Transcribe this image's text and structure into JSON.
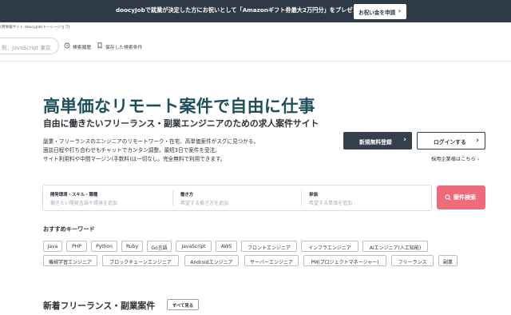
{
  "banner": {
    "text": "doocyJobで就業が決定した方にお祝いとして「Amazonギフト券最大2万円分」をプレゼント🎉",
    "button_label": "お祝い金を申請"
  },
  "header": {
    "tagline": "(用情報サイト doocyJob(ドーシージョブ)",
    "search_placeholder": "例：JavaScript 東京",
    "history_label": "検索履歴",
    "saved_label": "保存した検索条件"
  },
  "hero": {
    "title": "高単価なリモート案件で自由に仕事",
    "subtitle": "自由に働きたいフリーランス・副業エンジニアのための求人案件サイト",
    "description": [
      "副業・フリーランスのエンジニアのリモートワーク・在宅、高単価案件がスグに見つかる。",
      "面談日程や打ち合わせもチャットでカンタン調整。最短3日で案件を受注。",
      "サイト利用料や中間マージン(手数料)は一切なし。完全無料で利用できます。"
    ],
    "register_label": "新規無料登録",
    "login_label": "ログインする",
    "employer_link": "採用企業様はこちら"
  },
  "search": {
    "fields": [
      {
        "label": "開発環境・スキル・職種",
        "placeholder": "働きたい開発言語や環境を追加"
      },
      {
        "label": "働き方",
        "placeholder": "希望する働き方を追加"
      },
      {
        "label": "単価",
        "placeholder": "希望する単価を追加"
      }
    ],
    "button_label": "案件検索"
  },
  "keywords": {
    "heading": "おすすめキーワード",
    "rows": [
      [
        "Java",
        "PHP",
        "Python",
        "Ruby",
        "Go言語",
        "JavaScript",
        "AWS",
        "フロントエンジニア",
        "インフラエンジニア",
        "AIエンジニア(人工知能)"
      ],
      [
        "機械学習エンジニア",
        "ブロックチェーンエンジニア",
        "Androidエンジニア",
        "サーバーエンジニア",
        "PM(プロジェクトマネージャー)",
        "フリーランス",
        "副業"
      ]
    ]
  },
  "new_listings": {
    "heading": "新着フリーランス・副業案件",
    "see_all_label": "すべて見る"
  },
  "colors": {
    "banner_bg": "#2f3a47",
    "hero_title": "#1e4f5b",
    "search_button": "#f06b7a",
    "dark_button": "#343f4b"
  },
  "icons": {
    "banner_chevron": "chevron-right-icon",
    "history": "history-icon",
    "bookmark": "bookmark-icon",
    "search": "search-icon"
  }
}
